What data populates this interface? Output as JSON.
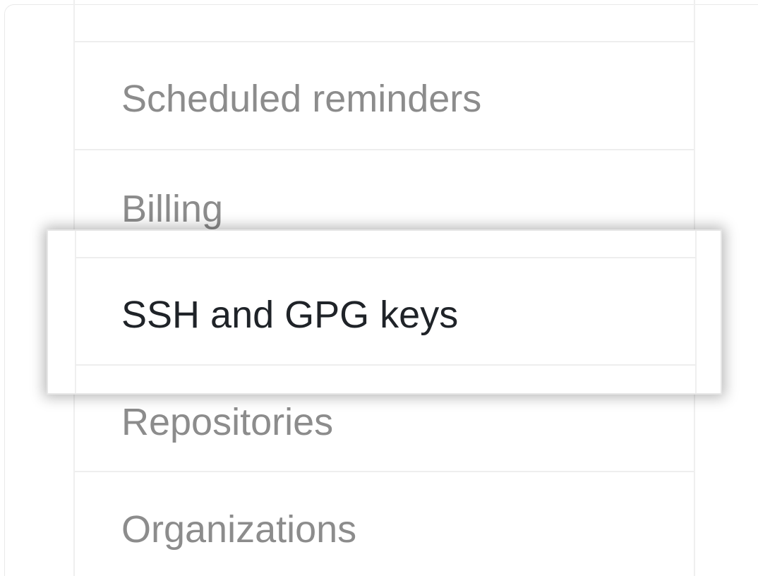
{
  "sidebar": {
    "items": [
      {
        "label": "Scheduled reminders"
      },
      {
        "label": "Billing"
      },
      {
        "label": "SSH and GPG keys"
      },
      {
        "label": "Repositories"
      },
      {
        "label": "Organizations"
      }
    ],
    "active_index": 2
  },
  "colors": {
    "inactive_text": "#8c8c8c",
    "active_text": "#1f2328",
    "divider": "#eeeeee"
  }
}
